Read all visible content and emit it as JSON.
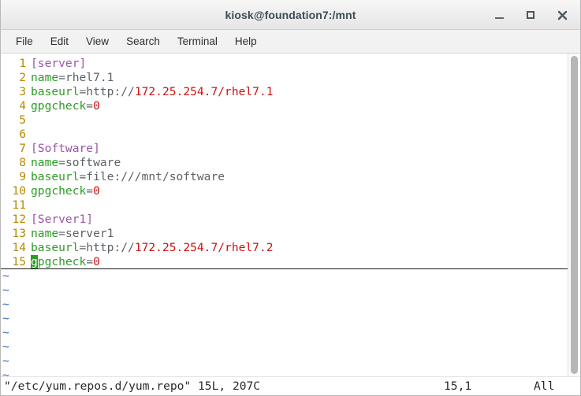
{
  "window": {
    "title": "kiosk@foundation7:/mnt",
    "controls": {
      "minimize": "minimize-icon",
      "maximize": "maximize-icon",
      "close": "close-icon"
    }
  },
  "menubar": {
    "items": [
      {
        "label": "File"
      },
      {
        "label": "Edit"
      },
      {
        "label": "View"
      },
      {
        "label": "Search"
      },
      {
        "label": "Terminal"
      },
      {
        "label": "Help"
      }
    ]
  },
  "editor": {
    "application": "vim",
    "lines": [
      {
        "num": "1",
        "segments": [
          {
            "text": "[server]",
            "type": "section"
          }
        ]
      },
      {
        "num": "2",
        "segments": [
          {
            "text": "name",
            "type": "key"
          },
          {
            "text": "=rhel7.1",
            "type": "plain"
          }
        ]
      },
      {
        "num": "3",
        "segments": [
          {
            "text": "baseurl",
            "type": "key"
          },
          {
            "text": "=http://",
            "type": "plain"
          },
          {
            "text": "172.25.254.7/rhel7.1",
            "type": "url"
          }
        ]
      },
      {
        "num": "4",
        "segments": [
          {
            "text": "gpgcheck",
            "type": "key"
          },
          {
            "text": "=",
            "type": "plain"
          },
          {
            "text": "0",
            "type": "num"
          }
        ]
      },
      {
        "num": "5",
        "segments": []
      },
      {
        "num": "6",
        "segments": []
      },
      {
        "num": "7",
        "segments": [
          {
            "text": "[Software]",
            "type": "section"
          }
        ]
      },
      {
        "num": "8",
        "segments": [
          {
            "text": "name",
            "type": "key"
          },
          {
            "text": "=software",
            "type": "plain"
          }
        ]
      },
      {
        "num": "9",
        "segments": [
          {
            "text": "baseurl",
            "type": "key"
          },
          {
            "text": "=file:///mnt/software",
            "type": "plain"
          }
        ]
      },
      {
        "num": "10",
        "segments": [
          {
            "text": "gpgcheck",
            "type": "key"
          },
          {
            "text": "=",
            "type": "plain"
          },
          {
            "text": "0",
            "type": "num"
          }
        ]
      },
      {
        "num": "11",
        "segments": []
      },
      {
        "num": "12",
        "segments": [
          {
            "text": "[Server1]",
            "type": "section"
          }
        ]
      },
      {
        "num": "13",
        "segments": [
          {
            "text": "name",
            "type": "key"
          },
          {
            "text": "=server1",
            "type": "plain"
          }
        ]
      },
      {
        "num": "14",
        "segments": [
          {
            "text": "baseurl",
            "type": "key"
          },
          {
            "text": "=http://",
            "type": "plain"
          },
          {
            "text": "172.25.254.7/rhel7.2",
            "type": "url"
          }
        ]
      },
      {
        "num": "15",
        "cursorline": true,
        "cursor_char": "g",
        "segments": [
          {
            "text": "pgcheck",
            "type": "key"
          },
          {
            "text": "=",
            "type": "plain"
          },
          {
            "text": "0",
            "type": "num"
          }
        ]
      }
    ],
    "empty_marker": "~",
    "empty_marker_count": 8
  },
  "statusline": {
    "file_info": "\"/etc/yum.repos.d/yum.repo\" 15L, 207C",
    "position": "15,1",
    "scroll": "All"
  },
  "colors": {
    "section": "#9a55a8",
    "key": "#2e9b27",
    "plain": "#5c6166",
    "number": "#d01010",
    "url": "#d01010",
    "linenumber": "#b58900",
    "tilde": "#4169b8",
    "cursor_bg": "#2e9b27",
    "background": "#ffffff"
  }
}
